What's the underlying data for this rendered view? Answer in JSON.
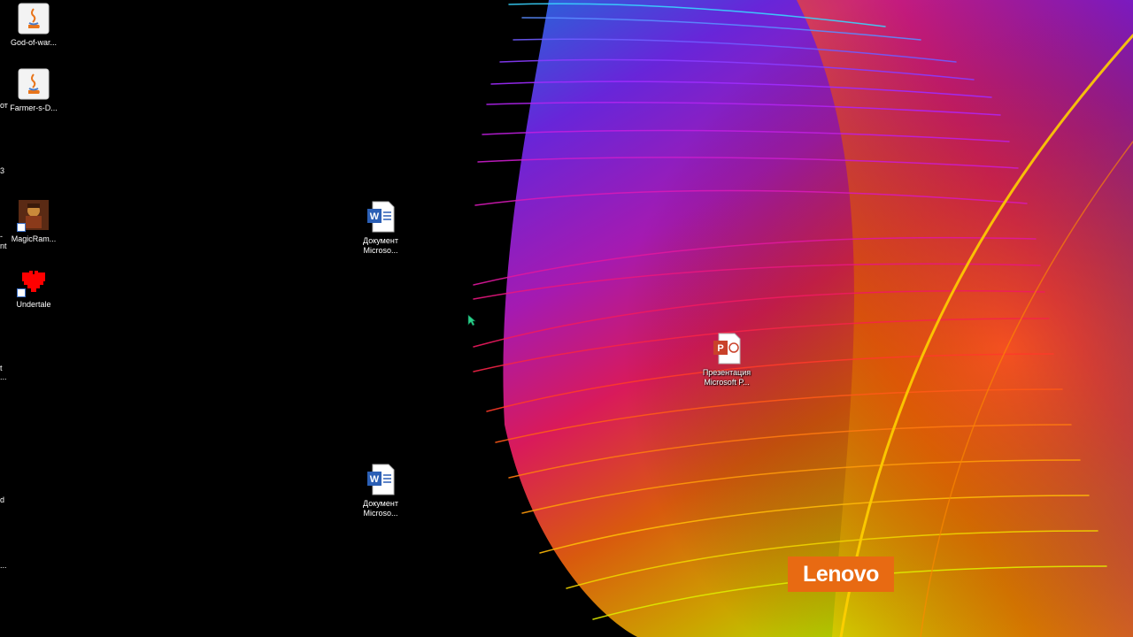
{
  "desktop": {
    "icons": [
      {
        "label": "God-of-war...",
        "type": "java-jar-icon"
      },
      {
        "label": "Farmer-s-D...",
        "type": "java-jar-icon"
      },
      {
        "label": "MagicRam...",
        "type": "game-shortcut-icon"
      },
      {
        "label": "Undertale",
        "type": "heart-shortcut-icon"
      },
      {
        "label": "Документ Microso...",
        "type": "word-document-icon"
      },
      {
        "label": "Презентация Microsoft P...",
        "type": "powerpoint-document-icon"
      },
      {
        "label": "Документ Microso...",
        "type": "word-document-icon"
      }
    ],
    "clipped_labels": [
      "от",
      "3",
      "-",
      "nt",
      "t",
      "...",
      "d",
      "..."
    ],
    "brand": {
      "text": "Lenovo",
      "color": "#e86a12"
    },
    "colors": {
      "background": "#000000",
      "feather_purple": "#8a2be2",
      "feather_magenta": "#e0218a",
      "feather_orange": "#ff6a00",
      "feather_yellow": "#e8e000"
    }
  }
}
